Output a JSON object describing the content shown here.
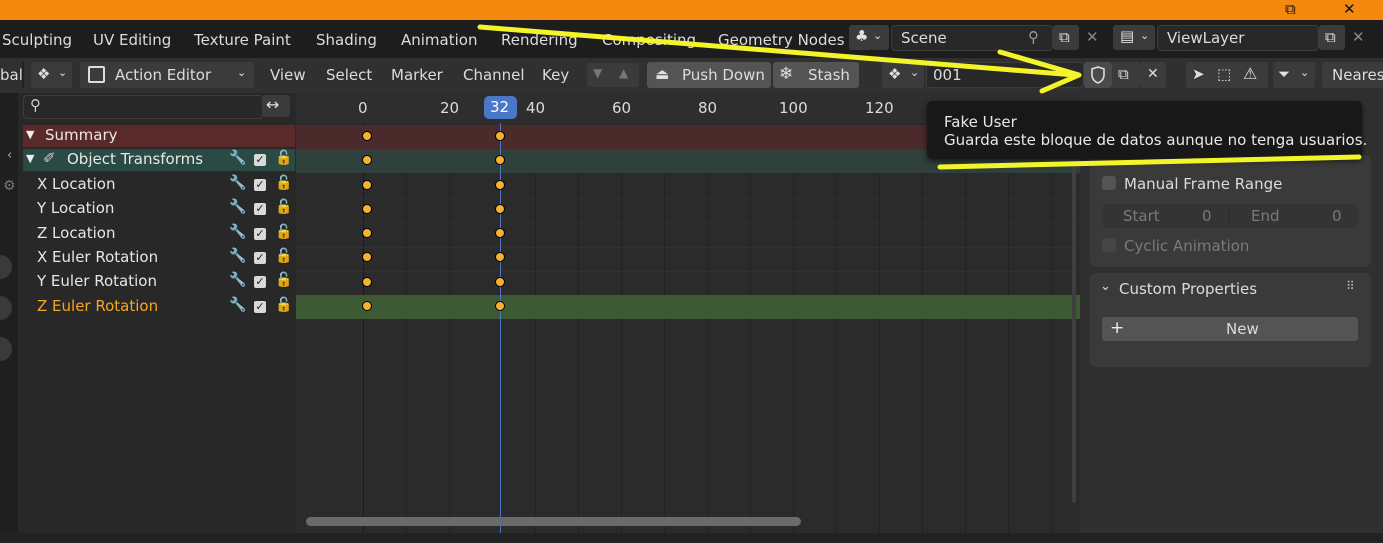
{
  "window": {
    "maximize_glyph": "⧉",
    "close_glyph": "✕"
  },
  "workspace_tabs": [
    "Sculpting",
    "UV Editing",
    "Texture Paint",
    "Shading",
    "Animation",
    "Rendering",
    "Compositing",
    "Geometry Nodes"
  ],
  "scene": {
    "name": "Scene"
  },
  "view_layer": {
    "name": "ViewLayer"
  },
  "header": {
    "left_cut": "bal",
    "editor_mode": "Action Editor",
    "menus": [
      "View",
      "Select",
      "Marker",
      "Channel",
      "Key"
    ],
    "push_down": "Push Down",
    "stash": "Stash",
    "action_name": "001",
    "interpolation_cut": "Neares"
  },
  "search": {
    "placeholder": ""
  },
  "ruler": {
    "labels": [
      "0",
      "20",
      "40",
      "60",
      "80",
      "100",
      "120"
    ],
    "current_frame": "32"
  },
  "channels": [
    {
      "label": "Summary"
    },
    {
      "label": "Object Transforms"
    },
    {
      "label": "X Location"
    },
    {
      "label": "Y Location"
    },
    {
      "label": "Z Location"
    },
    {
      "label": "X Euler Rotation"
    },
    {
      "label": "Y Euler Rotation"
    },
    {
      "label": "Z Euler Rotation"
    }
  ],
  "tooltip": {
    "title": "Fake User",
    "description": "Guarda este bloque de datos aunque no tenga usuarios."
  },
  "sidebar": {
    "manual_frame_range": "Manual Frame Range",
    "start_label": "Start",
    "start_value": "0",
    "end_label": "End",
    "end_value": "0",
    "cyclic_animation": "Cyclic Animation",
    "custom_properties": "Custom Properties",
    "new_button": "New"
  },
  "colors": {
    "title_bar": "#f5890f",
    "annotation": "#f4f42a",
    "summary_row": "#5a2a2a",
    "object_row": "#2a4a44",
    "selected_row": "#3e5a34",
    "active_channel_text": "#f5a623",
    "playhead": "#4a77c7",
    "keyframe": "#f6b130"
  }
}
